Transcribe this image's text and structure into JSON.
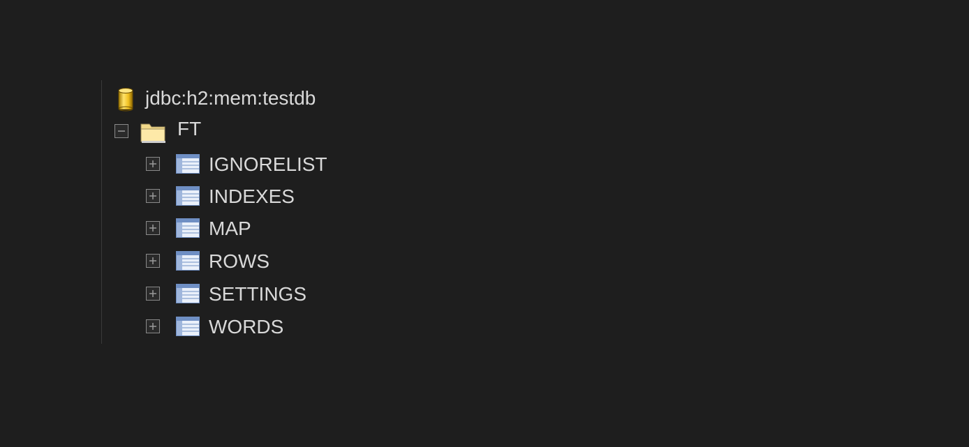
{
  "tree": {
    "root": {
      "label": "jdbc:h2:mem:testdb",
      "icon": "database-icon",
      "color": "#f0c020"
    },
    "schema": {
      "label": "FT",
      "icon": "folder-icon",
      "expanded": true
    },
    "tables": [
      {
        "label": "IGNORELIST",
        "icon": "table-icon",
        "expanded": false
      },
      {
        "label": "INDEXES",
        "icon": "table-icon",
        "expanded": false
      },
      {
        "label": "MAP",
        "icon": "table-icon",
        "expanded": false
      },
      {
        "label": "ROWS",
        "icon": "table-icon",
        "expanded": false
      },
      {
        "label": "SETTINGS",
        "icon": "table-icon",
        "expanded": false
      },
      {
        "label": "WORDS",
        "icon": "table-icon",
        "expanded": false
      }
    ]
  },
  "colors": {
    "background": "#1e1e1e",
    "text": "#d9d9d9",
    "table_icon": "#6f8fc4",
    "folder_icon": "#f2d98a"
  }
}
